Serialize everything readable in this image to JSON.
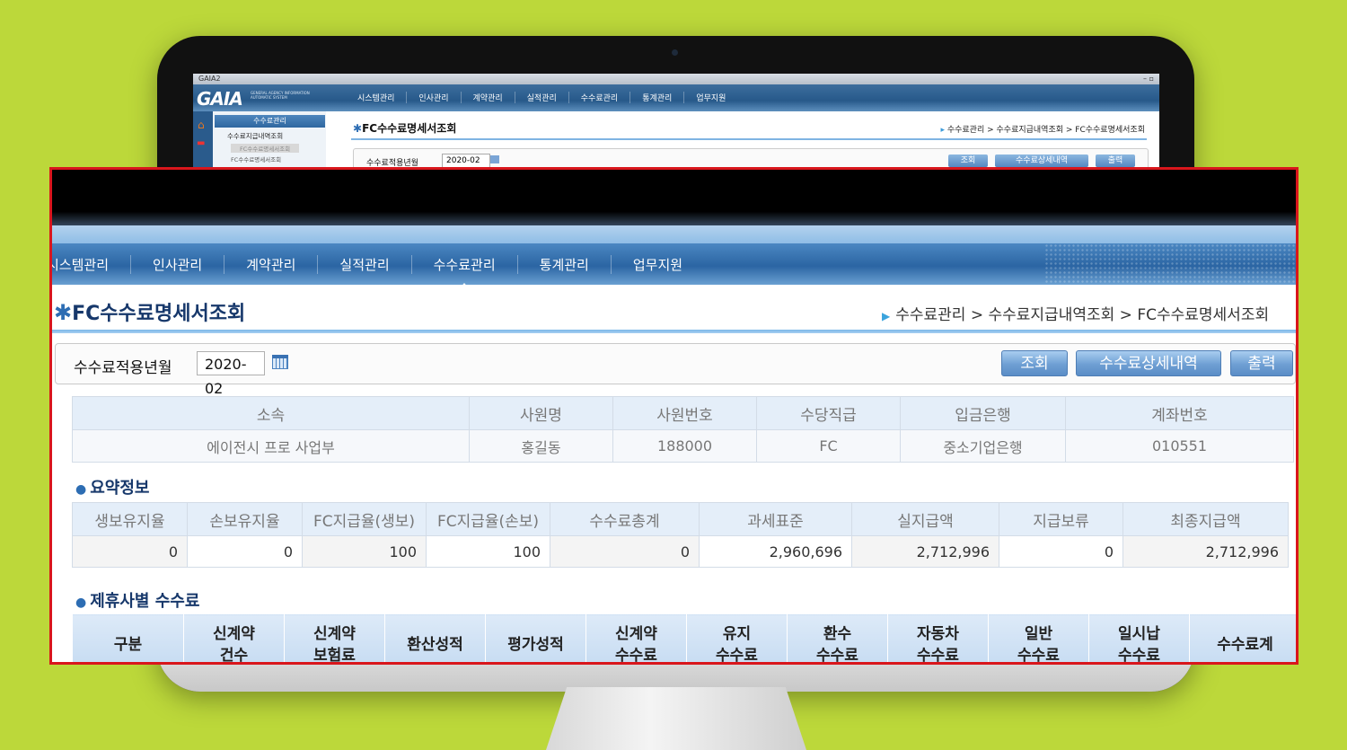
{
  "app": {
    "window_title": "GAIA2",
    "logo_text": "GAIA",
    "logo_subtitle": "GENERAL AGENCY INFORMATION AUTOMATIC SYSTEM",
    "window_controls": "– ▫"
  },
  "menu": [
    "시스템관리",
    "인사관리",
    "계약관리",
    "실적관리",
    "수수료관리",
    "통계관리",
    "업무지원"
  ],
  "zoom_menu": [
    "시스템관리",
    "인사관리",
    "계약관리",
    "실적관리",
    "수수료관리",
    "통계관리",
    "업무지원"
  ],
  "sidebar": {
    "title": "수수료관리",
    "tree_folder": "수수료지급내역조회",
    "tree_selected": "FC수수료명세서조회",
    "tree_next": "FC수수료명세서조회"
  },
  "page": {
    "title": "FC수수료명세서조회",
    "breadcrumb": [
      "수수료관리",
      "수수료지급내역조회",
      "FC수수료명세서조회"
    ],
    "breadcrumb_text": "수수료관리 > 수수료지급내역조회 > FC수수료명세서조회"
  },
  "filter": {
    "label": "수수료적용년월",
    "value": "2020-02"
  },
  "buttons": {
    "search": "조회",
    "detail": "수수료상세내역",
    "print": "출력"
  },
  "employee": {
    "headers": [
      "소속",
      "사원명",
      "사원번호",
      "수당직급",
      "입금은행",
      "계좌번호"
    ],
    "row": [
      "에이전시 프로 사업부",
      "홍길동",
      "188000",
      "FC",
      "중소기업은행",
      "010551"
    ]
  },
  "summary": {
    "title": "요약정보",
    "headers": [
      "생보유지율",
      "손보유지율",
      "FC지급율(생보)",
      "FC지급율(손보)",
      "수수료총계",
      "과세표준",
      "실지급액",
      "지급보류",
      "최종지급액"
    ],
    "values": [
      "0",
      "0",
      "100",
      "100",
      "0",
      "2,960,696",
      "2,712,996",
      "0",
      "2,712,996"
    ]
  },
  "partner_fees": {
    "title": "제휴사별 수수료",
    "headers": [
      "구분",
      "신계약\n건수",
      "신계약\n보험료",
      "환산성적",
      "평가성적",
      "신계약\n수수료",
      "유지\n수수료",
      "환수\n수수료",
      "자동차\n수수료",
      "일반\n수수료",
      "일시납\n수수료",
      "수수료계"
    ]
  },
  "colors": {
    "background": "#bcd83a",
    "highlight_border": "#d9161c",
    "title_text": "#17386b",
    "header_blue": "#2b65a3"
  }
}
